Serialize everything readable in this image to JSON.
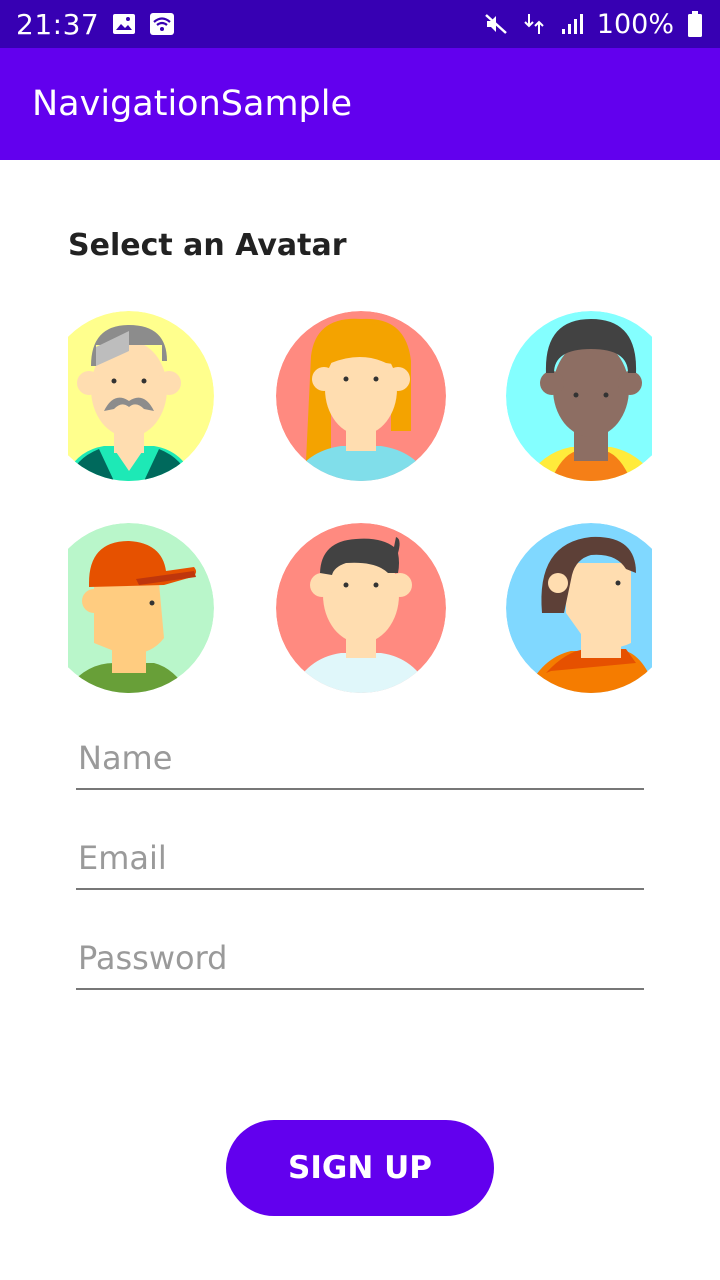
{
  "status_bar": {
    "time": "21:37",
    "battery": "100%",
    "icons_left": [
      "image-icon",
      "wifi-calling-icon"
    ],
    "icons_right": [
      "mute-icon",
      "data-transfer-icon",
      "signal-icon",
      "battery-icon"
    ]
  },
  "app_bar": {
    "title": "NavigationSample",
    "color": "#6200EE"
  },
  "avatar_section": {
    "title": "Select an Avatar",
    "avatars": [
      {
        "name": "avatar-old-man",
        "bg": "#FFFF8D"
      },
      {
        "name": "avatar-woman-blonde",
        "bg": "#FF8A80"
      },
      {
        "name": "avatar-man-dark",
        "bg": "#84FFFF"
      },
      {
        "name": "avatar-man-cap",
        "bg": "#B9F6CA"
      },
      {
        "name": "avatar-boy",
        "bg": "#FF8A80"
      },
      {
        "name": "avatar-woman-brunette",
        "bg": "#80D8FF"
      }
    ]
  },
  "form": {
    "name_placeholder": "Name",
    "email_placeholder": "Email",
    "password_placeholder": "Password"
  },
  "signup_button": {
    "label": "SIGN UP"
  }
}
